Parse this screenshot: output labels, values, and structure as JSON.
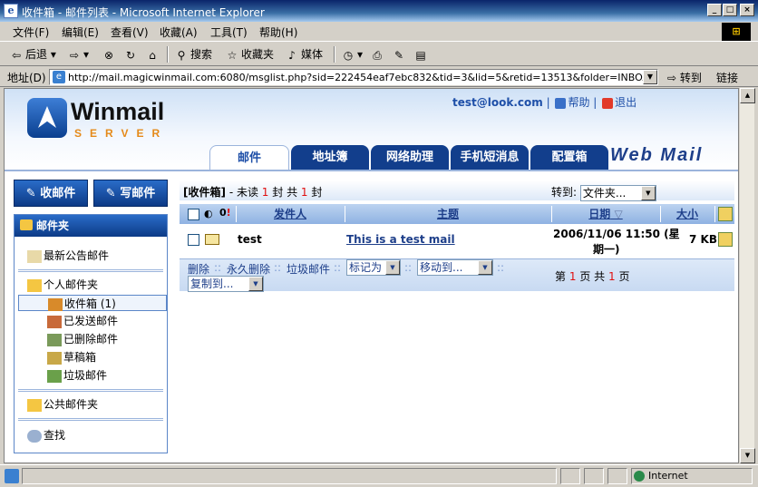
{
  "window": {
    "title": "收件箱 - 邮件列表 - Microsoft Internet Explorer",
    "buttons": {
      "min": "_",
      "max": "□",
      "close": "×"
    }
  },
  "menu": [
    "文件(F)",
    "编辑(E)",
    "查看(V)",
    "收藏(A)",
    "工具(T)",
    "帮助(H)"
  ],
  "toolbar": {
    "back": "后退",
    "search": "搜索",
    "favorites": "收藏夹",
    "media": "媒体"
  },
  "address": {
    "label": "地址(D)",
    "url": "http://mail.magicwinmail.com:6080/msglist.php?sid=222454eaf7ebc832&tid=3&lid=5&retid=13513&folder=INBOX",
    "go": "转到",
    "links": "链接"
  },
  "header": {
    "logo_name": "Winmail",
    "logo_sub": "SERVER",
    "user": "test@look.com",
    "help": "帮助",
    "logout": "退出",
    "webmail": "Web Mail"
  },
  "tabs": [
    "邮件",
    "地址簿",
    "网络助理",
    "手机短消息",
    "配置箱"
  ],
  "sidebar": {
    "receive": "收邮件",
    "compose": "写邮件",
    "folders_title": "邮件夹",
    "announcements": "最新公告邮件",
    "personal": "个人邮件夹",
    "inbox": "收件箱 (1)",
    "sent": "已发送邮件",
    "deleted": "已删除邮件",
    "drafts": "草稿箱",
    "junk": "垃圾邮件",
    "public": "公共邮件夹",
    "search": "查找"
  },
  "list": {
    "folder": "[收件箱]",
    "unread_prefix": "- 未读",
    "unread_count": "1",
    "unit1": "封 共",
    "total_count": "1",
    "unit2": "封",
    "jump_label": "转到:",
    "jump_value": "文件夹...",
    "columns": {
      "from": "发件人",
      "subject": "主题",
      "date": "日期",
      "size": "大小"
    },
    "rows": [
      {
        "from": "test",
        "subject": "This is a test mail",
        "date": "2006/11/06 11:50 (星",
        "date2": "期一)",
        "size": "7 KB"
      }
    ]
  },
  "actions": {
    "delete": "删除",
    "delete_perm": "永久删除",
    "junk": "垃圾邮件",
    "mark_as": "标记为",
    "move_to": "移动到...",
    "copy_to": "复制到...",
    "page_prefix": "第",
    "page_current": "1",
    "page_mid": "页 共",
    "page_total": "1",
    "page_suffix": "页"
  },
  "status": {
    "zone": "Internet"
  },
  "colors": {
    "brand_blue": "#123e8c",
    "accent_orange": "#e58a1a",
    "red": "#e01010"
  }
}
